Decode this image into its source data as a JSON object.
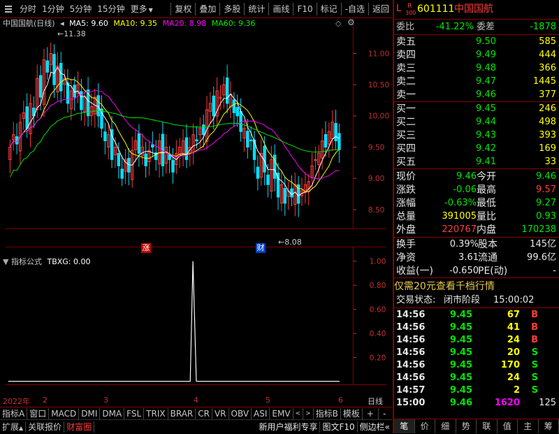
{
  "toolbar": {
    "left": [
      "分时",
      "1分钟",
      "5分钟",
      "15分钟",
      "更多"
    ],
    "right": [
      "复权",
      "叠加",
      "多股",
      "统计",
      "画线",
      "F10",
      "标记",
      "-自选",
      "返回"
    ]
  },
  "chart": {
    "title": "中国国航(日线)",
    "ma": [
      {
        "label": "MA5: 9.60",
        "color": "#ffffff"
      },
      {
        "label": "MA10: 9.35",
        "color": "#ffff00"
      },
      {
        "label": "MA20: 8.98",
        "color": "#ff00ff"
      },
      {
        "label": "MA60: 9.36",
        "color": "#00e600"
      }
    ],
    "price_ticks": [
      "11.00",
      "10.50",
      "10.00",
      "9.50",
      "9.00",
      "8.50"
    ],
    "high_label": "11.38",
    "low_label": "8.08",
    "badge_zhang": "涨",
    "badge_cai": "财",
    "indicator_title": "指标公式",
    "indicator_value": "TBXG: 0.00",
    "ind_ticks": [
      "1.00",
      "0.80",
      "0.60",
      "0.40",
      "0.20"
    ],
    "dates": [
      "2022年",
      "2",
      "3",
      "4",
      "5",
      "6"
    ],
    "period": "日线"
  },
  "bottom_tabs": [
    "指标A",
    "窗口",
    "MACD",
    "DMI",
    "DMA",
    "FSL",
    "TRIX",
    "BRAR",
    "CR",
    "VR",
    "OBV",
    "ASI",
    "EMV",
    "指标B",
    "模板",
    "+",
    "-"
  ],
  "bottom_row2": {
    "left": [
      "扩展",
      "关联报价",
      "财富圈"
    ],
    "right": [
      "新用户福利专享",
      "图文F10",
      "侧边栏"
    ]
  },
  "quote": {
    "flag_l": "L",
    "flag_r": "R",
    "flag_num": "300",
    "code": "601111",
    "name": "中国国航",
    "weibi_label": "委比",
    "weibi": "-41.22%",
    "weicha_label": "委差",
    "weicha": "-1878",
    "asks": [
      {
        "label": "卖五",
        "price": "9.50",
        "vol": "585"
      },
      {
        "label": "卖四",
        "price": "9.49",
        "vol": "444"
      },
      {
        "label": "卖三",
        "price": "9.48",
        "vol": "366"
      },
      {
        "label": "卖二",
        "price": "9.47",
        "vol": "1445"
      },
      {
        "label": "卖一",
        "price": "9.46",
        "vol": "377"
      }
    ],
    "bids": [
      {
        "label": "买一",
        "price": "9.45",
        "vol": "246"
      },
      {
        "label": "买二",
        "price": "9.44",
        "vol": "498"
      },
      {
        "label": "买三",
        "price": "9.43",
        "vol": "393"
      },
      {
        "label": "买四",
        "price": "9.42",
        "vol": "169"
      },
      {
        "label": "买五",
        "price": "9.41",
        "vol": "33"
      }
    ],
    "stats": [
      {
        "l1": "现价",
        "v1": "9.46",
        "c1": "grn",
        "l2": "今开",
        "v2": "9.46",
        "c2": "grn"
      },
      {
        "l1": "涨跌",
        "v1": "-0.06",
        "c1": "grn",
        "l2": "最高",
        "v2": "9.57",
        "c2": "red"
      },
      {
        "l1": "涨幅",
        "v1": "-0.63%",
        "c1": "grn",
        "l2": "最低",
        "v2": "9.27",
        "c2": "grn"
      },
      {
        "l1": "总量",
        "v1": "391005",
        "c1": "yel",
        "l2": "量比",
        "v2": "0.93",
        "c2": "grn"
      },
      {
        "l1": "外盘",
        "v1": "220767",
        "c1": "red",
        "l2": "内盘",
        "v2": "170238",
        "c2": "grn"
      }
    ],
    "stats2": [
      {
        "l1": "换手",
        "v1": "0.39%",
        "l2": "股本",
        "v2": "145亿"
      },
      {
        "l1": "净资",
        "v1": "3.61",
        "l2": "流通",
        "v2": "99.6亿"
      },
      {
        "l1": "收益(一)",
        "v1": "-0.650",
        "l2": "PE(动)",
        "v2": "-"
      }
    ],
    "promo": "仅需20元查看千档行情",
    "status_label": "交易状态:",
    "status": "闭市阶段",
    "status_time": "15:00:02",
    "ticks": [
      {
        "t": "14:56",
        "p": "9.45",
        "v": "67",
        "s": "B"
      },
      {
        "t": "14:56",
        "p": "9.45",
        "v": "41",
        "s": "B"
      },
      {
        "t": "14:56",
        "p": "9.45",
        "v": "24",
        "s": "B"
      },
      {
        "t": "14:56",
        "p": "9.45",
        "v": "20",
        "s": "S"
      },
      {
        "t": "14:56",
        "p": "9.45",
        "v": "170",
        "s": "S"
      },
      {
        "t": "14:56",
        "p": "9.45",
        "v": "24",
        "s": "S"
      },
      {
        "t": "14:57",
        "p": "9.45",
        "v": "2",
        "s": "S"
      },
      {
        "t": "15:00",
        "p": "9.46",
        "v": "1620",
        "s": "125"
      }
    ],
    "side_tabs": [
      "笔",
      "价",
      "细",
      "势",
      "联",
      "值",
      "主",
      "筹"
    ]
  }
}
